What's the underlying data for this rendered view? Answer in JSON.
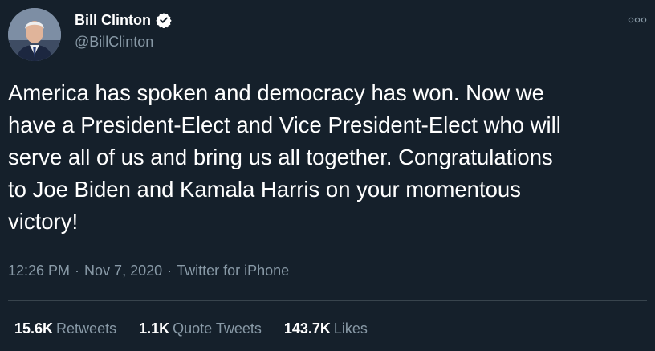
{
  "author": {
    "name": "Bill Clinton",
    "handle": "@BillClinton",
    "verified_icon": "verified-badge-icon"
  },
  "tweet": {
    "text": "America has spoken and democracy has won. Now we\nhave a President-Elect and Vice President-Elect who will\nserve all of us and bring us all together. Congratulations\nto Joe Biden and Kamala Harris on your momentous\nvictory!",
    "time": "12:26 PM",
    "date": "Nov 7, 2020",
    "source": "Twitter for iPhone",
    "separator": "·"
  },
  "stats": {
    "retweets_count": "15.6K",
    "retweets_label": "Retweets",
    "quotes_count": "1.1K",
    "quotes_label": "Quote Tweets",
    "likes_count": "143.7K",
    "likes_label": "Likes"
  },
  "colors": {
    "background": "#15202b",
    "text_primary": "#ffffff",
    "text_secondary": "#8899a6",
    "divider": "#38444d"
  }
}
